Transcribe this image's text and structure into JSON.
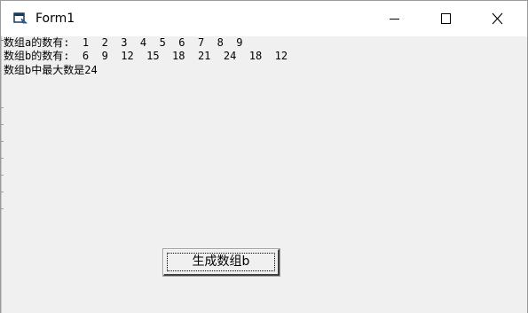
{
  "window": {
    "title": "Form1",
    "icon": "vb-form-icon",
    "controls": {
      "minimize_icon": "minimize-icon",
      "maximize_icon": "maximize-icon",
      "close_icon": "close-icon"
    }
  },
  "output": {
    "line1": "数组a的数有:  1  2  3  4  5  6  7  8  9",
    "line2": "数组b的数有:  6  9  12  15  18  21  24  18  12",
    "line3": "数组b中最大数是24"
  },
  "button": {
    "label": "生成数组b"
  },
  "colors": {
    "titlebar": "#ffffff",
    "client": "#f0f0f0",
    "text": "#000000"
  }
}
